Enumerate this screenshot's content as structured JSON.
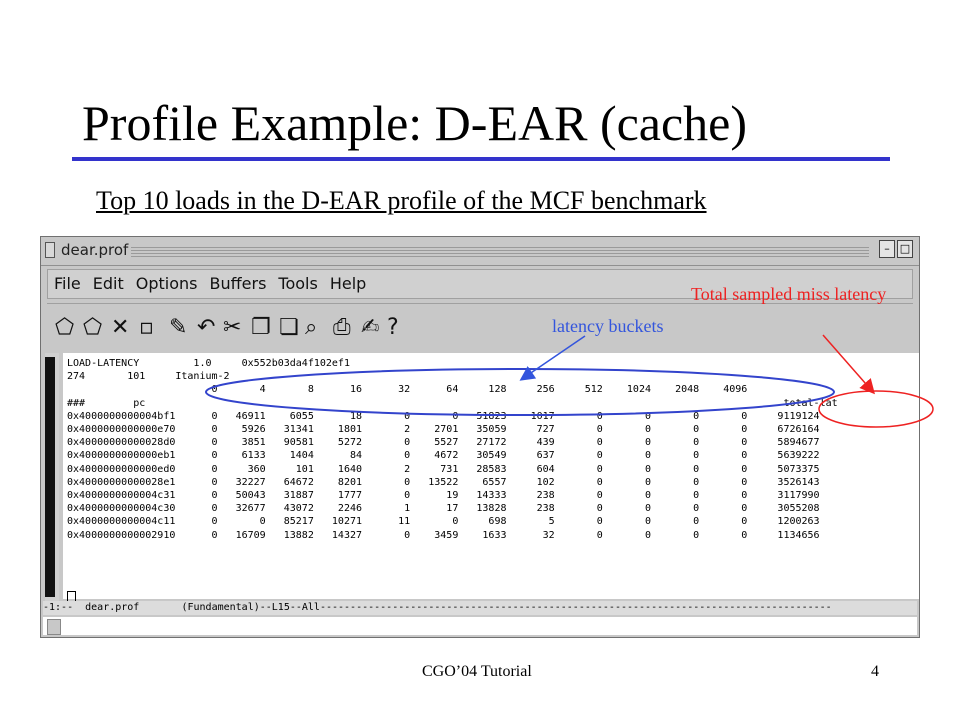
{
  "slide": {
    "title": "Profile Example: D-EAR (cache)",
    "subtitle": "Top 10 loads in the D-EAR profile of the MCF benchmark",
    "footer": "CGO’04 Tutorial",
    "page_number": "4",
    "accent_color": "#3333cc"
  },
  "window": {
    "title": "dear.prof",
    "buttons": {
      "minimize": "–",
      "maximize": "□",
      "close": "×"
    },
    "menu": [
      "File",
      "Edit",
      "Options",
      "Buffers",
      "Tools",
      "Help"
    ],
    "toolbar_icons": [
      "open-file-icon",
      "open-folder-icon",
      "close-buffer-icon",
      "save-icon",
      "edit-icon",
      "undo-icon",
      "cut-icon",
      "copy-icon",
      "paste-icon",
      "search-icon",
      "print-icon",
      "preferences-icon",
      "help-icon"
    ],
    "modeline": "-1:--  dear.prof       (Fundamental)--L15--All-------------------------------------------------------------------------------------"
  },
  "profile": {
    "lines": [
      "LOAD-LATENCY         1.0     0x552b03da4f102ef1",
      "274       101     Itanium-2",
      "                        0       4       8      16      32      64     128     256     512    1024    2048    4096",
      "###        pc                                                                                                          total-lat",
      "0x4000000000004bf1      0   46911    6055      18       0       0   51823    1017       0       0       0       0     9119124",
      "0x4000000000000e70      0    5926   31341    1801       2    2701   35059     727       0       0       0       0     6726164",
      "0x40000000000028d0      0    3851   90581    5272       0    5527   27172     439       0       0       0       0     5894677",
      "0x4000000000000eb1      0    6133    1404      84       0    4672   30549     637       0       0       0       0     5639222",
      "0x4000000000000ed0      0     360     101    1640       2     731   28583     604       0       0       0       0     5073375",
      "0x40000000000028e1      0   32227   64672    8201       0   13522    6557     102       0       0       0       0     3526143",
      "0x4000000000004c31      0   50043   31887    1777       0      19   14333     238       0       0       0       0     3117990",
      "0x4000000000004c30      0   32677   43072    2246       1      17   13828     238       0       0       0       0     3055208",
      "0x4000000000004c11      0       0   85217   10271      11       0     698       5       0       0       0       0     1200263",
      "0x4000000000002910      0   16709   13882   14327       0    3459    1633      32       0       0       0       0     1134656"
    ]
  },
  "annotations": {
    "total_label": "Total sampled miss latency",
    "buckets_label": "latency buckets",
    "red_color": "#ee2222",
    "blue_color": "#3355dd"
  }
}
